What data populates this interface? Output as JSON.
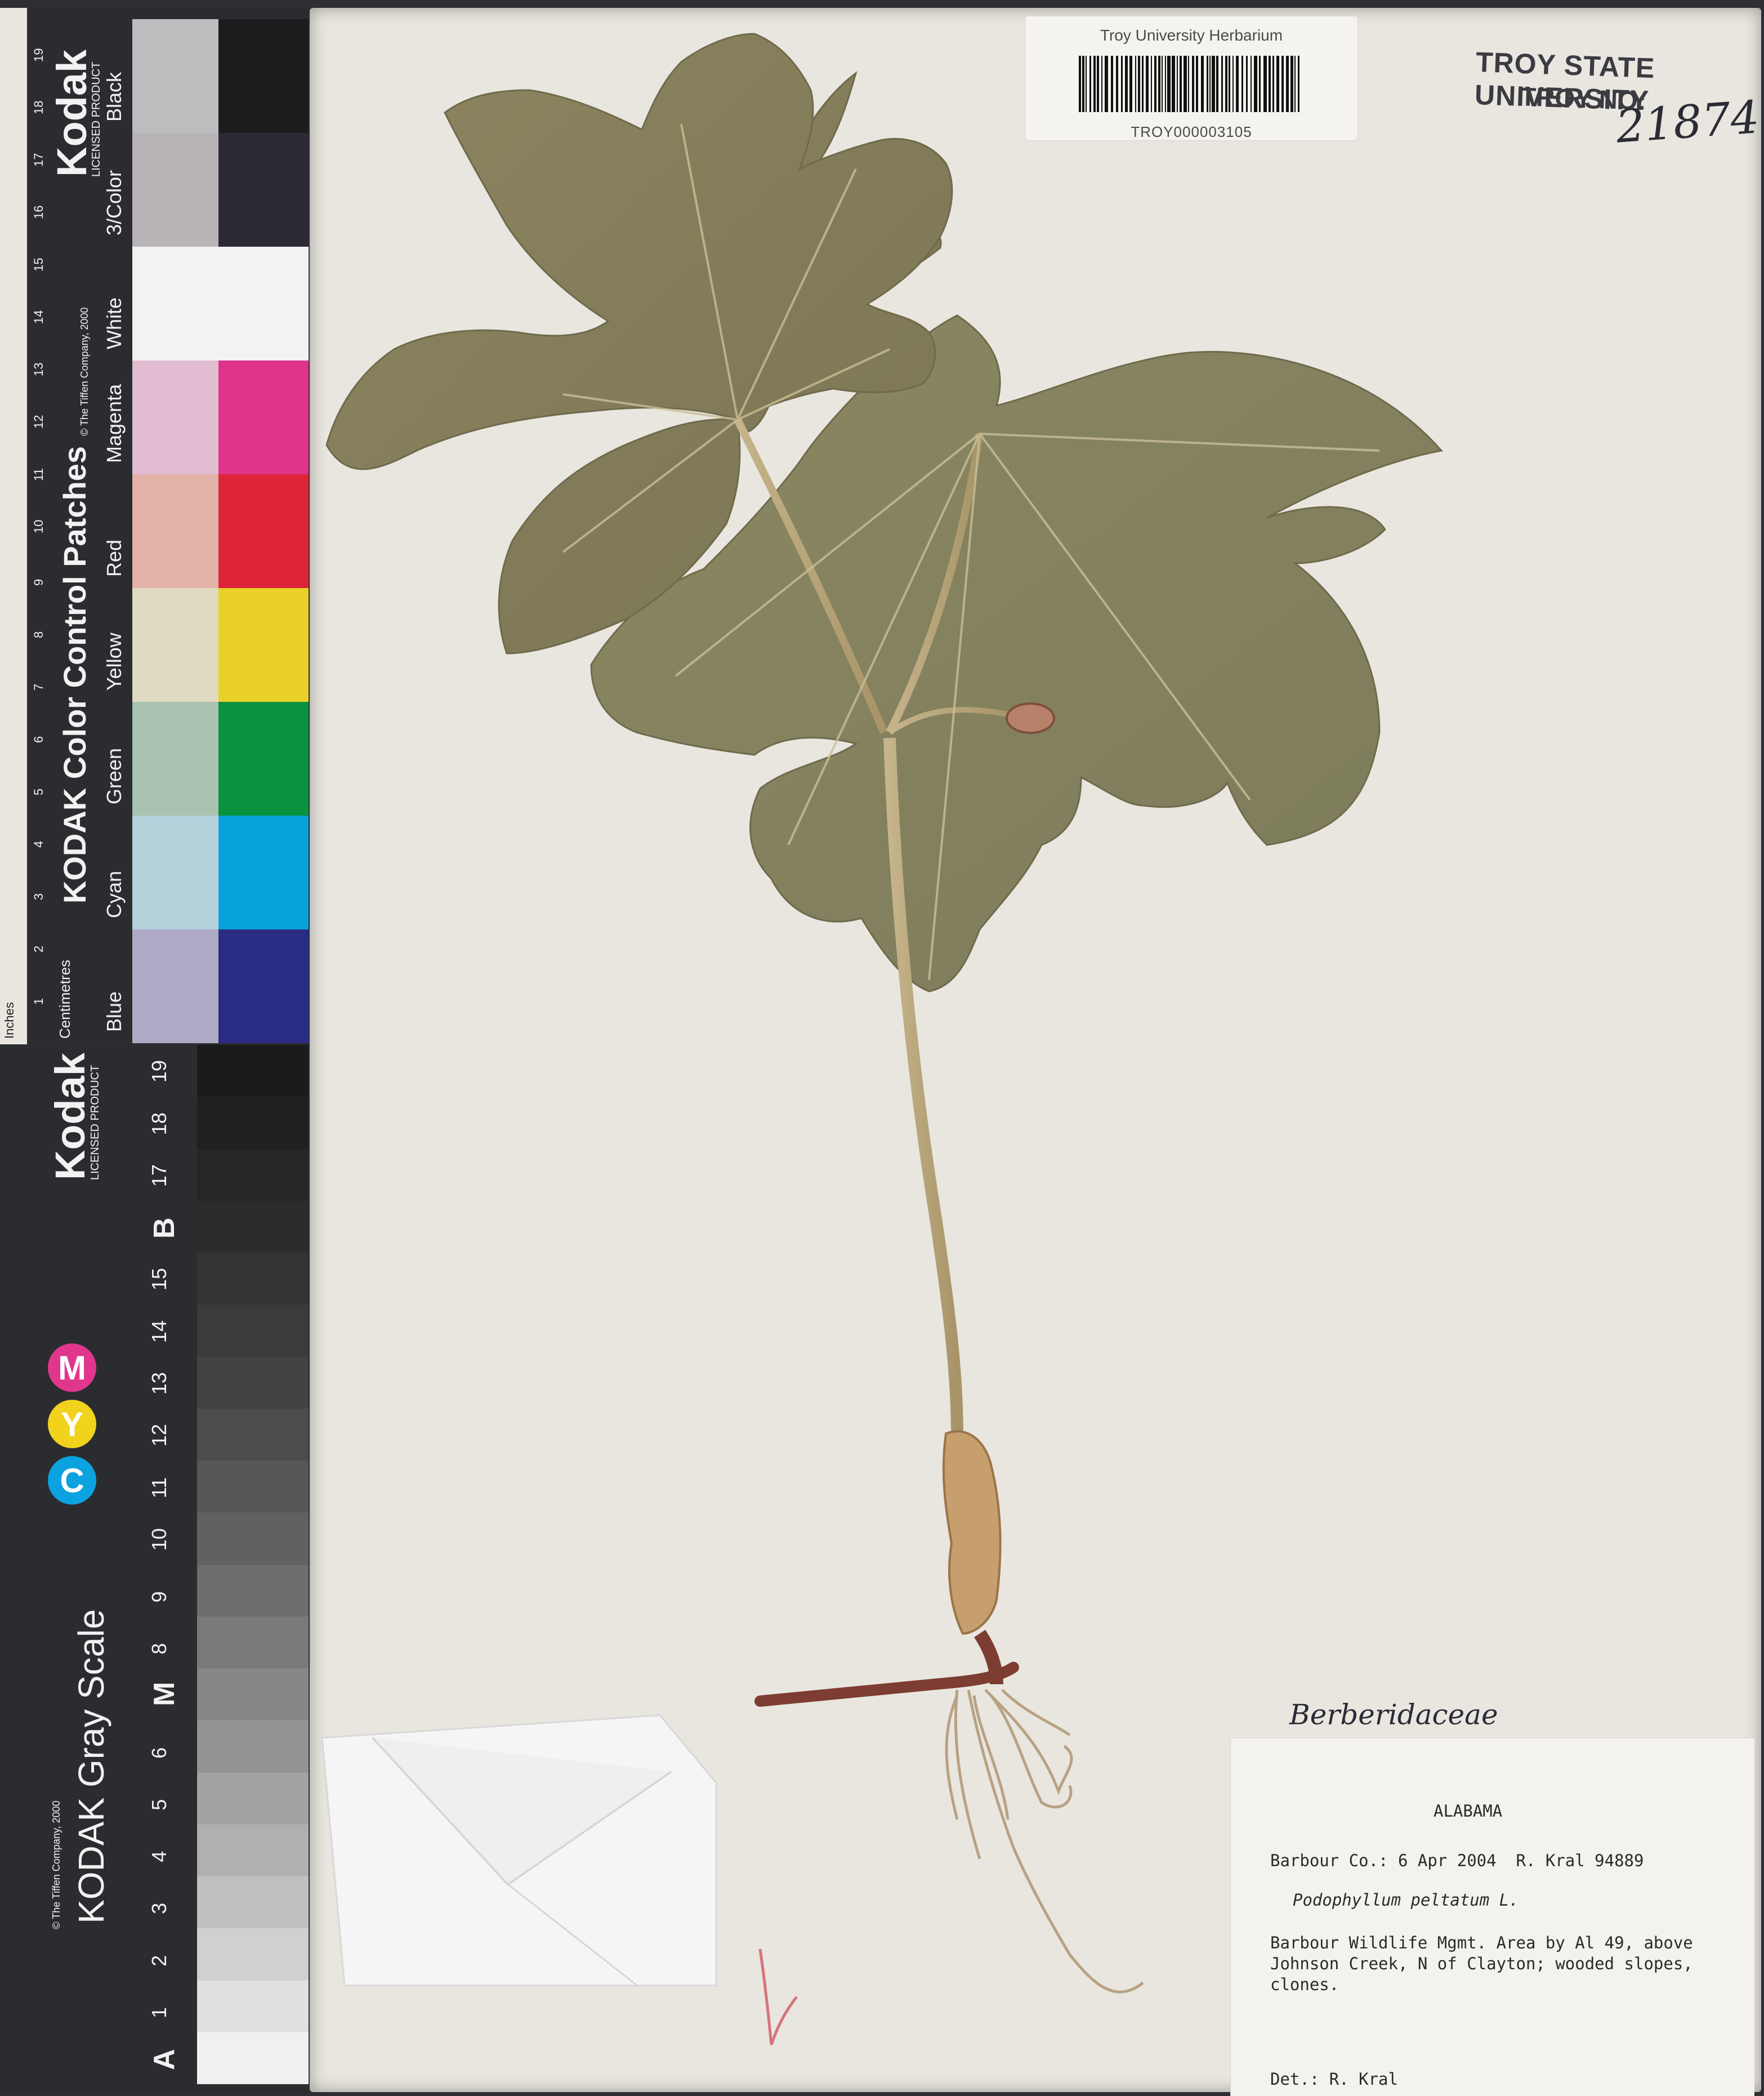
{
  "herbarium_label": {
    "institution": "Troy University Herbarium",
    "catalog_number": "TROY000003105"
  },
  "stamp": {
    "line1": "TROY STATE UNIVERSITY",
    "line2": "TROY NO:",
    "number": "21874"
  },
  "family": "Berberidaceae",
  "specimen_label": {
    "state": "ALABAMA",
    "collection": "Barbour Co.: 6 Apr 2004  R. Kral 94889",
    "taxon": "Podophyllum peltatum L.",
    "locality": "Barbour Wildlife Mgmt. Area by Al 49, above Johnson Creek, N of Clayton; wooded slopes, clones.",
    "determiner": "Det.: R. Kral"
  },
  "color_card": {
    "brand": "Kodak",
    "licensed": "LICENSED PRODUCT",
    "title": "KODAK Color Control Patches",
    "copyright": "© The Tiffen Company, 2000",
    "units_inches": "Inches",
    "units_cm": "Centimetres",
    "patches": [
      {
        "label": "Blue",
        "light": "#aeaac6",
        "dark": "#2a2b83"
      },
      {
        "label": "Cyan",
        "light": "#b4d2dc",
        "dark": "#08a2da"
      },
      {
        "label": "Green",
        "light": "#a9c3b0",
        "dark": "#0a9241"
      },
      {
        "label": "Yellow",
        "light": "#e0dbc1",
        "dark": "#e9d129"
      },
      {
        "label": "Red",
        "light": "#e2b1a8",
        "dark": "#de2537"
      },
      {
        "label": "Magenta",
        "light": "#e2bcd0",
        "dark": "#e0338a"
      },
      {
        "label": "White",
        "light": "#f2f2f2",
        "dark": "#f2f2f2"
      },
      {
        "label": "3/Color",
        "light": "#b9b4b8",
        "dark": "#2d2a35"
      },
      {
        "label": "Black",
        "light": "#bdbdbf",
        "dark": "#1c1c1f"
      }
    ],
    "cm_ticks": [
      "1",
      "2",
      "3",
      "4",
      "5",
      "6",
      "7",
      "8",
      "9",
      "10",
      "11",
      "12",
      "13",
      "14",
      "15",
      "16",
      "17",
      "18",
      "19"
    ]
  },
  "gray_card": {
    "brand": "Kodak",
    "licensed": "LICENSED PRODUCT",
    "title": "KODAK Gray Scale",
    "copyright": "© The Tiffen Company, 2000",
    "cmy": [
      "C",
      "Y",
      "M"
    ],
    "steps": [
      "A",
      "1",
      "2",
      "3",
      "4",
      "5",
      "6",
      "M",
      "8",
      "9",
      "10",
      "11",
      "12",
      "13",
      "14",
      "15",
      "B",
      "17",
      "18",
      "19"
    ],
    "gray_levels": [
      "#f0f0f0",
      "#e0e0e0",
      "#d0d0d0",
      "#c0c0c0",
      "#b0b0b0",
      "#a3a3a3",
      "#949494",
      "#878787",
      "#7a7a7a",
      "#6d6d6d",
      "#616161",
      "#565656",
      "#4c4c4c",
      "#434343",
      "#3b3b3b",
      "#333333",
      "#2c2c2c",
      "#262626",
      "#202020",
      "#1b1b1b"
    ]
  }
}
